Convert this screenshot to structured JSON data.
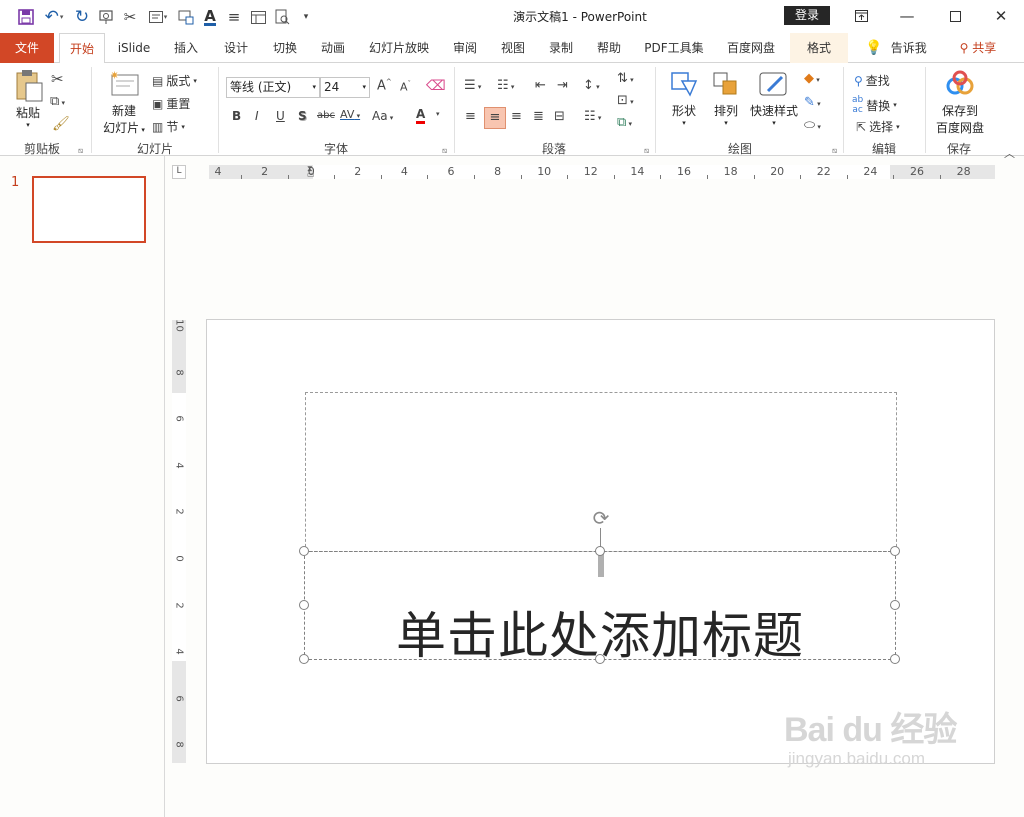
{
  "title_bar": {
    "document_title": "演示文稿1  -  PowerPoint",
    "login_label": "登录",
    "quick_access": [
      "save-icon",
      "undo-icon",
      "redo-icon",
      "present-from-start-icon",
      "cut-icon",
      "layout-icon",
      "screenshot-icon",
      "font-color-icon",
      "align-icon",
      "table-icon",
      "preview-icon",
      "customize-icon"
    ]
  },
  "tabs": [
    {
      "label": "文件"
    },
    {
      "label": "开始"
    },
    {
      "label": "iSlide"
    },
    {
      "label": "插入"
    },
    {
      "label": "设计"
    },
    {
      "label": "切换"
    },
    {
      "label": "动画"
    },
    {
      "label": "幻灯片放映"
    },
    {
      "label": "审阅"
    },
    {
      "label": "视图"
    },
    {
      "label": "录制"
    },
    {
      "label": "帮助"
    },
    {
      "label": "PDF工具集"
    },
    {
      "label": "百度网盘"
    },
    {
      "label": "格式"
    }
  ],
  "tell_me": "告诉我",
  "share": "共享",
  "ribbon": {
    "clipboard": {
      "label": "剪贴板",
      "paste": "粘贴"
    },
    "slides": {
      "label": "幻灯片",
      "new_slide_1": "新建",
      "new_slide_2": "幻灯片",
      "layout": "版式",
      "reset": "重置",
      "section": "节"
    },
    "font": {
      "label": "字体",
      "font_name": "等线 (正文)",
      "font_size": "24",
      "bold": "B",
      "italic": "I",
      "underline": "U",
      "shadow": "S",
      "strike": "abc",
      "spacing": "AV",
      "case": "Aa",
      "grow": "A",
      "shrink": "A",
      "color": "A"
    },
    "paragraph": {
      "label": "段落"
    },
    "drawing": {
      "label": "绘图",
      "shapes": "形状",
      "arrange": "排列",
      "quick_styles": "快速样式"
    },
    "editing": {
      "label": "编辑",
      "find": "查找",
      "replace": "替换",
      "select": "选择"
    },
    "save": {
      "label": "保存",
      "save_to_1": "保存到",
      "save_to_2": "百度网盘"
    }
  },
  "slide_panel": {
    "slide_number": "1"
  },
  "ruler": {
    "h_ticks": [
      "4",
      "2",
      "0",
      "2",
      "4",
      "6",
      "8",
      "10",
      "12",
      "14",
      "16",
      "18",
      "20",
      "22",
      "24",
      "26",
      "28"
    ],
    "v_ticks": [
      "10",
      "8",
      "6",
      "4",
      "2",
      "0",
      "2",
      "4",
      "6",
      "8"
    ],
    "corner": "L"
  },
  "slide": {
    "title_placeholder": "单击此处添加标题"
  },
  "watermark": {
    "main": "Bai du 经验",
    "sub": "jingyan.baidu.com"
  }
}
